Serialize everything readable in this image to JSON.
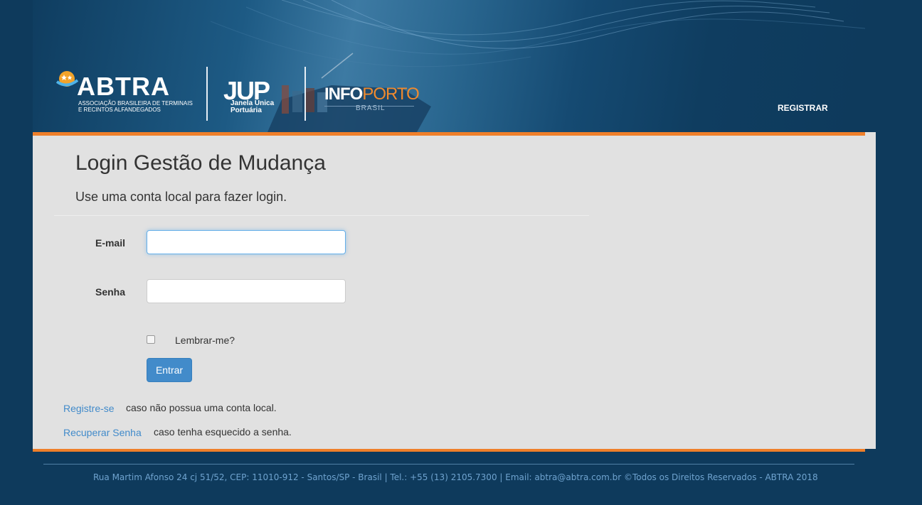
{
  "header": {
    "abtra": {
      "title": "ABTRA",
      "subtitle_line1": "ASSOCIAÇÃO BRASILEIRA DE TERMINAIS",
      "subtitle_line2": "E RECINTOS ALFANDEGADOS"
    },
    "jup": {
      "title": "JUP",
      "subtitle_line1": "Janela Única",
      "subtitle_line2": "Portuária"
    },
    "infoporto": {
      "title_info": "INFO",
      "title_porto": "PORTO",
      "subtitle": "BRASIL"
    },
    "registrar_label": "REGISTRAR"
  },
  "login": {
    "title": "Login Gestão de Mudança",
    "subtitle": "Use uma conta local para fazer login.",
    "email_label": "E-mail",
    "email_value": "",
    "password_label": "Senha",
    "password_value": "",
    "remember_label": "Lembrar-me?",
    "remember_checked": false,
    "submit_label": "Entrar",
    "register_link": "Registre-se",
    "register_text": "caso não possua uma conta local.",
    "recover_link": "Recuperar Senha",
    "recover_text": "caso tenha esquecido a senha."
  },
  "footer": {
    "text": "Rua Martim Afonso 24 cj 51/52, CEP: 11010-912 - Santos/SP - Brasil | Tel.: +55 (13) 2105.7300 | Email: abtra@abtra.com.br ©Todos os Direitos Reservados - ABTRA 2018"
  },
  "colors": {
    "background": "#0e3a5c",
    "accent": "#ef7f2a",
    "panel": "#e1e1e1",
    "primary_button": "#428bca",
    "link": "#428bca"
  }
}
